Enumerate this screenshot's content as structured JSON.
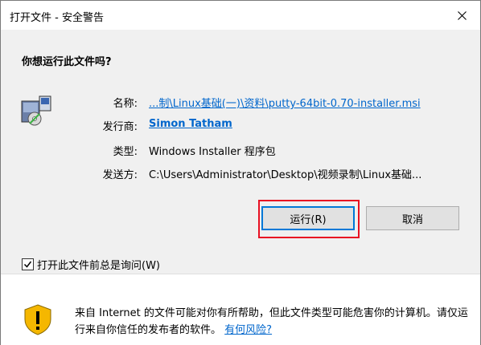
{
  "window": {
    "title": "打开文件 - 安全警告"
  },
  "dialog": {
    "question": "你想运行此文件吗?",
    "fields": [
      {
        "label": "名称:",
        "value": "...制\\Linux基础(一)\\资料\\putty-64bit-0.70-installer.msi"
      },
      {
        "label": "发行商:",
        "value": "Simon Tatham"
      },
      {
        "label": "类型:",
        "value": "Windows Installer 程序包"
      },
      {
        "label": "发送方:",
        "value": "C:\\Users\\Administrator\\Desktop\\视频录制\\Linux基础..."
      }
    ],
    "run_button": "运行(R)",
    "cancel_button": "取消",
    "checkbox_label": "打开此文件前总是询问(W)",
    "checkbox_checked": true
  },
  "footer": {
    "warning_text": "来自 Internet 的文件可能对你有所帮助，但此文件类型可能危害你的计算机。请仅运行来自你信任的发布者的软件。",
    "risk_link": "有何风险?"
  },
  "colors": {
    "accent": "#0078d7",
    "link": "#0066cc",
    "highlight_box": "#e81123",
    "shield": "#f5b700"
  },
  "icons": [
    "close-icon",
    "msi-installer-icon",
    "checkmark-icon",
    "warning-shield-icon"
  ]
}
